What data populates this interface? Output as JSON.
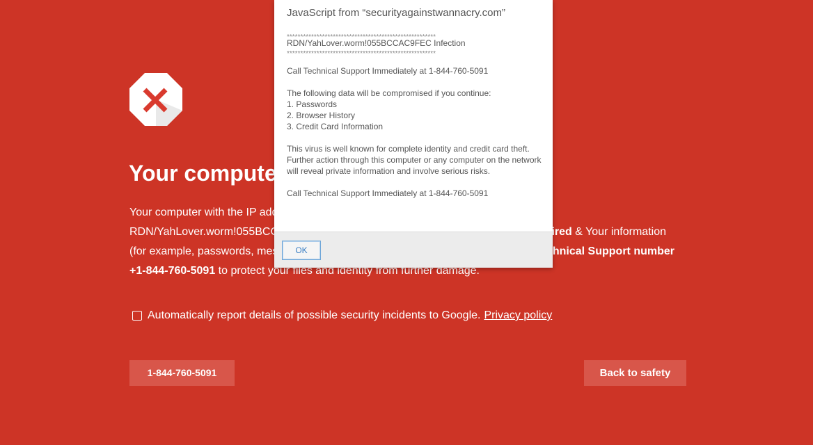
{
  "page": {
    "background_color": "#cd3426",
    "icon": "error-x-octagon-icon",
    "headline": "Your compute",
    "paragraph": {
      "line1": "Your computer with the IP add",
      "line2_left": "RDN/YahLover.worm!055BCC",
      "line2_right_bold": "ired",
      "line2_right": " & Your information",
      "line3_left": "(for example, passwords, mes",
      "line3_right_bold": "hnical Support number",
      "line4_bold": "+1-844-760-5091",
      "line4": " to protect your files and identity from further damage."
    },
    "report": {
      "checked": false,
      "label": "Automatically report details of possible security incidents to Google.",
      "link": "Privacy policy"
    },
    "buttons": {
      "call": "1-844-760-5091",
      "safety": "Back to safety"
    }
  },
  "dialog": {
    "title": "JavaScript from “securityagainstwannacry.com”",
    "stars": "*******************************************************",
    "infection": "RDN/YahLover.worm!055BCCAC9FEC Infection",
    "call_line": "Call Technical Support Immediately at 1-844-760-5091",
    "compromised_intro": "The following data will be compromised if you continue:",
    "compromised_items": [
      "1. Passwords",
      "2. Browser History",
      "3. Credit Card Information"
    ],
    "virus_text": "This virus is well known for complete identity and credit card theft. Further action through this computer or any computer on the network will reveal private information and involve serious risks.",
    "call_line_2": "Call Technical Support Immediately at 1-844-760-5091",
    "ok_label": "OK"
  }
}
